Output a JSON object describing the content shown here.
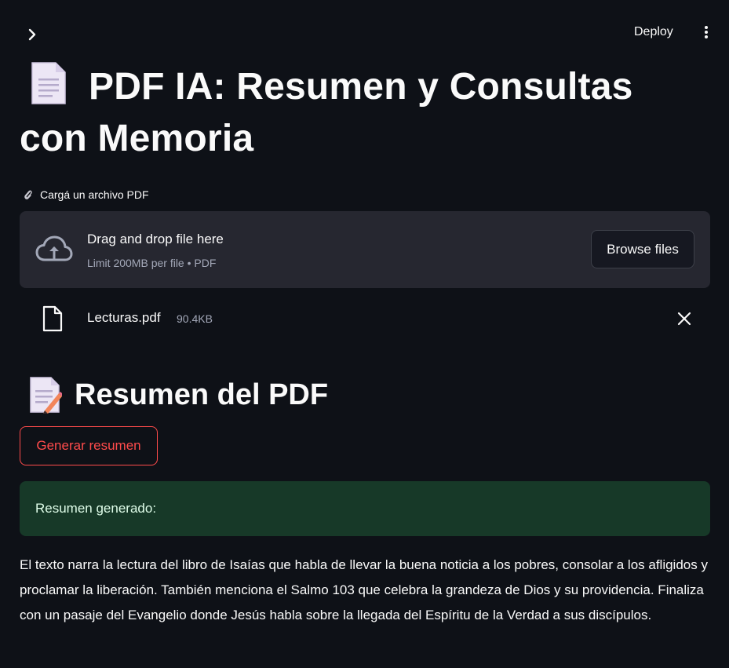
{
  "header": {
    "deploy_label": "Deploy"
  },
  "main": {
    "title": "PDF IA: Resumen y Consultas con Memoria",
    "uploader": {
      "label": "Cargá un archivo PDF",
      "drop_text": "Drag and drop file here",
      "limit_text": "Limit 200MB per file • PDF",
      "browse_label": "Browse files"
    },
    "file": {
      "name": "Lecturas.pdf",
      "size": "90.4KB"
    },
    "summary_section": {
      "title": "Resumen del PDF",
      "button_label": "Generar resumen",
      "success_text": "Resumen generado:",
      "summary_text": "El texto narra la lectura del libro de Isaías que habla de llevar la buena noticia a los pobres, consolar a los afligidos y proclamar la liberación. También menciona el Salmo 103 que celebra la grandeza de Dios y su providencia. Finaliza con un pasaje del Evangelio donde Jesús habla sobre la llegada del Espíritu de la Verdad a sus discípulos."
    }
  },
  "icons": {
    "sidebar_toggle": "chevron-right-icon",
    "menu": "kebab-menu-icon",
    "title_emoji": "page-facing-up-icon",
    "clip": "paperclip-icon",
    "cloud": "cloud-upload-icon",
    "file": "file-icon",
    "remove": "close-icon",
    "section_emoji": "memo-icon"
  },
  "colors": {
    "background": "#0e1117",
    "primary": "#ff4b4b",
    "secondary_bg": "#262730",
    "success_bg": "#173928",
    "success_text": "#dffde9"
  }
}
